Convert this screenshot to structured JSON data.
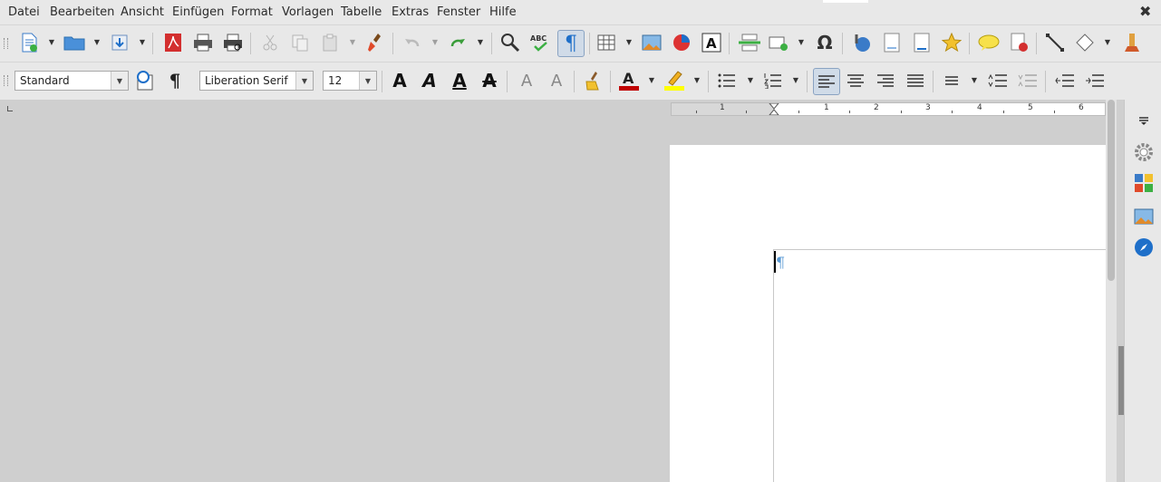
{
  "menu": {
    "items": [
      "Datei",
      "Bearbeiten",
      "Ansicht",
      "Einfügen",
      "Format",
      "Vorlagen",
      "Tabelle",
      "Extras",
      "Fenster",
      "Hilfe"
    ],
    "close_glyph": "✖"
  },
  "standard_toolbar": {
    "icons": [
      "new-document-icon",
      "open-folder-icon",
      "save-icon",
      "export-pdf-icon",
      "print-icon",
      "print-preview-icon",
      "cut-icon",
      "copy-icon",
      "paste-icon",
      "clone-formatting-icon",
      "undo-icon",
      "redo-icon",
      "find-replace-icon",
      "spellcheck-icon",
      "formatting-marks-icon",
      "table-icon",
      "image-icon",
      "chart-icon",
      "textbox-icon",
      "page-break-icon",
      "field-icon",
      "special-character-icon",
      "hyperlink-icon",
      "footnote-icon",
      "endnote-icon",
      "bookmark-icon",
      "comment-icon",
      "track-changes-icon",
      "line-icon",
      "basic-shapes-icon",
      "draw-functions-icon"
    ],
    "special_character_glyph": "Ω",
    "spellcheck_glyph": "ABC",
    "pilcrow_glyph": "¶"
  },
  "formatting_toolbar": {
    "paragraph_style": "Standard",
    "font_name": "Liberation Serif",
    "font_size": "12",
    "glyph_A": "A"
  },
  "ruler": {
    "labels": [
      "1",
      "1",
      "2",
      "3",
      "4",
      "5",
      "6"
    ]
  },
  "document": {
    "paragraph_mark": "¶"
  },
  "colors": {
    "font_color": "#c00000",
    "highlight_color": "#ffff00",
    "accent": "#1e6fc9"
  }
}
